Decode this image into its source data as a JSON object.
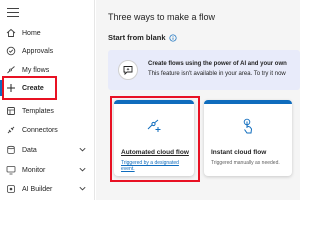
{
  "sidebar": {
    "items": [
      {
        "label": "Home",
        "icon": "home-icon"
      },
      {
        "label": "Approvals",
        "icon": "approvals-icon"
      },
      {
        "label": "My flows",
        "icon": "my-flows-icon"
      },
      {
        "label": "Create",
        "icon": "plus-icon"
      },
      {
        "label": "Templates",
        "icon": "templates-icon"
      },
      {
        "label": "Connectors",
        "icon": "connectors-icon"
      },
      {
        "label": "Data",
        "icon": "data-icon"
      },
      {
        "label": "Monitor",
        "icon": "monitor-icon"
      },
      {
        "label": "AI Builder",
        "icon": "ai-builder-icon"
      }
    ]
  },
  "main": {
    "title": "Three ways to make a flow",
    "section": "Start from blank",
    "banner": {
      "line1": "Create flows using the power of AI and your own",
      "line2": "This feature isn't available in your area. To try it now"
    },
    "cards": [
      {
        "name": "Automated cloud flow",
        "desc": "Triggered by a designated event."
      },
      {
        "name": "Instant cloud flow",
        "desc": "Triggered manually as needed."
      }
    ]
  },
  "colors": {
    "accent": "#0f6cbd",
    "highlight": "#e81123",
    "banner_bg": "#e8ebfa"
  }
}
